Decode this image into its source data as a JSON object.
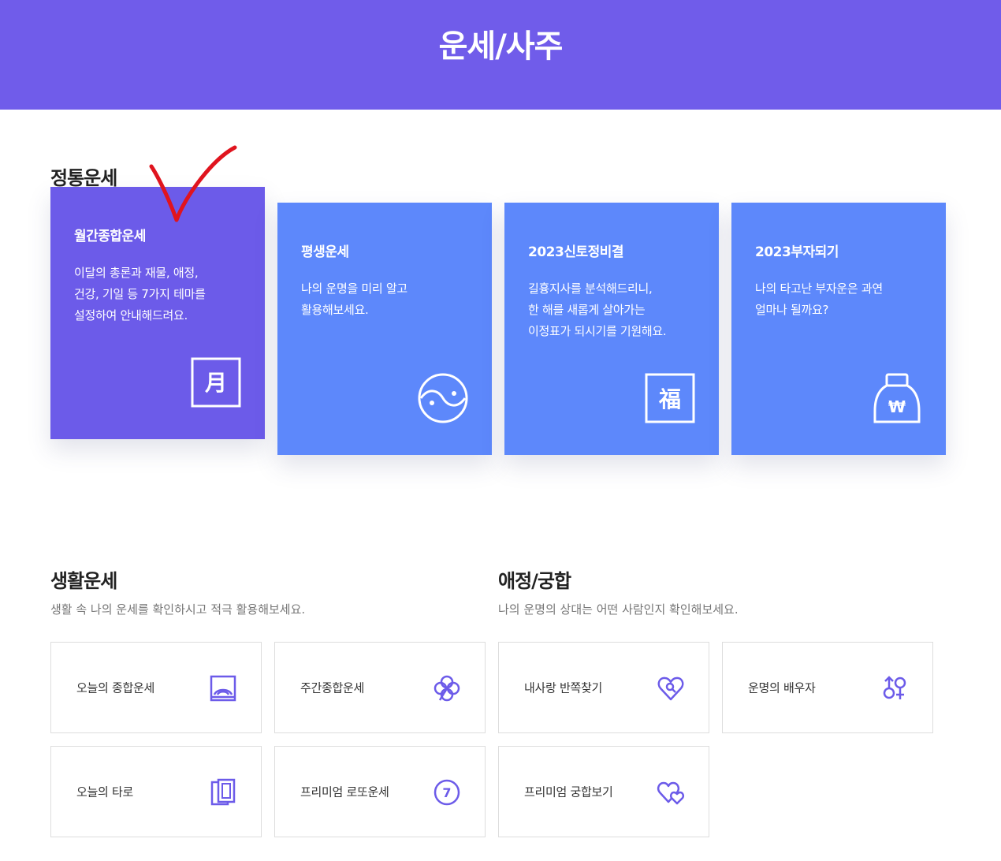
{
  "header": {
    "title": "운세/사주"
  },
  "traditional": {
    "title": "정통운세",
    "cards": [
      {
        "title": "월간종합운세",
        "desc": [
          "이달의 총론과 재물, 애정,",
          "건강, 기일 등 7가지 테마를",
          "설정하여 안내해드려요."
        ],
        "icon": "moon-character-icon",
        "icon_text": "月",
        "active": true
      },
      {
        "title": "평생운세",
        "desc": [
          "나의 운명을 미리 알고",
          "활용해보세요."
        ],
        "icon": "yin-yang-icon"
      },
      {
        "title": "2023신토정비결",
        "desc": [
          "길흉지사를 분석해드리니,",
          "한 해를 새롭게 살아가는",
          "이정표가 되시기를 기원해요."
        ],
        "icon": "fortune-character-icon",
        "icon_text": "福"
      },
      {
        "title": "2023부자되기",
        "desc": [
          "나의 타고난 부자운은 과연",
          "얼마나 될까요?"
        ],
        "icon": "money-bag-icon",
        "icon_text": "₩"
      }
    ]
  },
  "life": {
    "title": "생활운세",
    "desc": "생활 속 나의 운세를 확인하시고 적극 활용해보세요.",
    "items": [
      {
        "label": "오늘의 종합운세",
        "icon": "sunrise-icon"
      },
      {
        "label": "주간종합운세",
        "icon": "clover-icon"
      },
      {
        "label": "오늘의 타로",
        "icon": "tarot-cards-icon"
      },
      {
        "label": "프리미엄 로또운세",
        "icon": "lotto-ball-icon",
        "icon_text": "7"
      }
    ]
  },
  "love": {
    "title": "애정/궁합",
    "desc": "나의 운명의 상대는 어떤 사람인지 확인해보세요.",
    "items": [
      {
        "label": "내사랑 반쪽찾기",
        "icon": "heart-search-icon"
      },
      {
        "label": "운명의 배우자",
        "icon": "gender-symbols-icon"
      },
      {
        "label": "프리미엄 궁합보기",
        "icon": "double-heart-icon"
      }
    ]
  },
  "colors": {
    "header": "#705cea",
    "card": "#5d88fb",
    "card_active": "#6c5be9",
    "icon_stroke": "#6c5be9",
    "annotation": "#e0141e"
  }
}
